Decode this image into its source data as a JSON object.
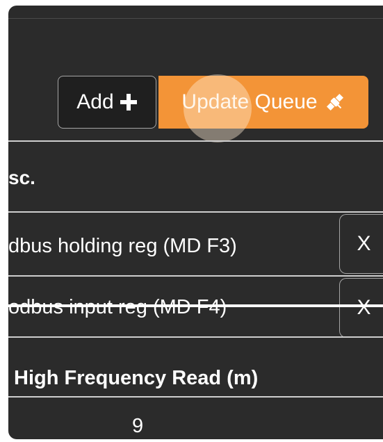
{
  "toolbar": {
    "add_label": "Add",
    "add_icon": "plus-icon",
    "update_label": "Update Queue",
    "update_icon": "satellite-icon"
  },
  "section": {
    "title": "sc."
  },
  "queue": {
    "items": [
      {
        "label": "dbus holding reg (MD F3)",
        "remove_label": "X",
        "struck": false
      },
      {
        "label": "odbus input reg (MD F4)",
        "remove_label": "X",
        "struck": true
      }
    ]
  },
  "table": {
    "headers": [
      "High Frequency Read (m)"
    ],
    "rows": [
      [
        "9"
      ]
    ]
  },
  "colors": {
    "panel_bg": "#2b2b2b",
    "accent": "#f39437",
    "divider": "#cfcfcf"
  }
}
